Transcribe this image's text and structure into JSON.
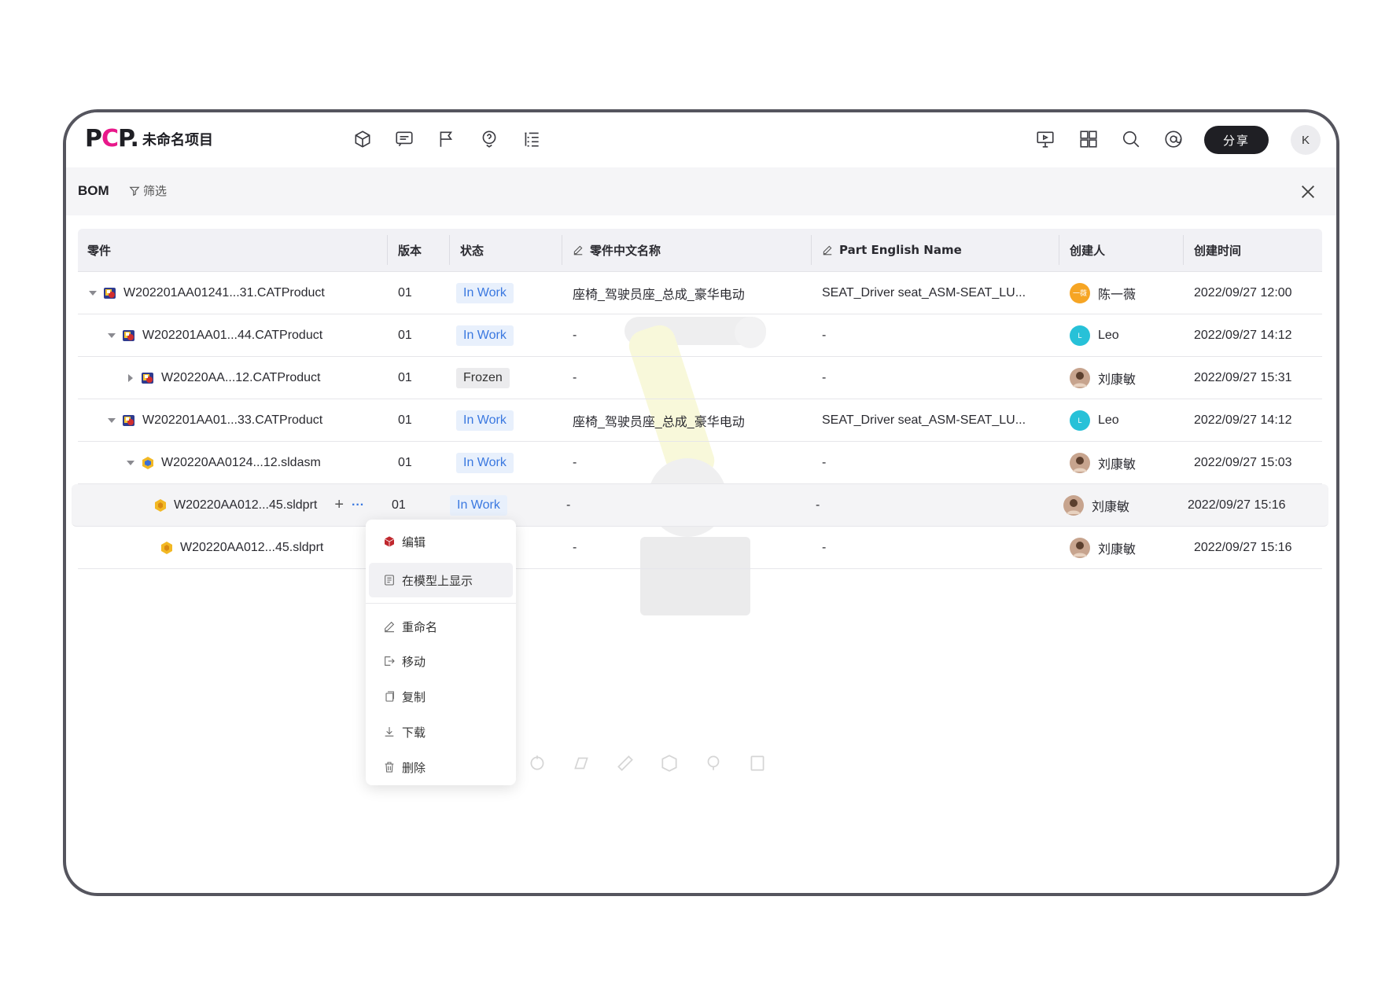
{
  "app": {
    "logo_p": "P",
    "logo_c": "C",
    "logo_rest": "P.",
    "project_title": "未命名项目"
  },
  "toolbar": {
    "left_icons": [
      "cube-icon",
      "comment-icon",
      "flag-icon",
      "help-icon",
      "list-icon"
    ],
    "right_icons": [
      "presentation-icon",
      "grid-icon",
      "search-icon",
      "at-icon"
    ],
    "share_label": "分享",
    "user_initial": "K"
  },
  "bom": {
    "title": "BOM",
    "filter_label": "筛选"
  },
  "columns": [
    "零件",
    "版本",
    "状态",
    "零件中文名称",
    "Part English Name",
    "创建人",
    "创建时间"
  ],
  "rows": [
    {
      "name": "W202201AA01241...31.CATProduct",
      "version": "01",
      "status": "In Work",
      "cn_name": "座椅_驾驶员座_总成_豪华电动",
      "en_name": "SEAT_Driver seat_ASM-SEAT_LU...",
      "creator": "陈一薇",
      "creator_avatar": "一薇",
      "created": "2022/09/27 12:00",
      "level": 0,
      "expander": "expanded",
      "icon": "catproduct-icon"
    },
    {
      "name": "W202201AA01...44.CATProduct",
      "version": "01",
      "status": "In Work",
      "cn_name": "-",
      "en_name": "-",
      "creator": "Leo",
      "creator_avatar": "L",
      "created": "2022/09/27 14:12",
      "level": 1,
      "expander": "expanded",
      "icon": "catproduct-icon"
    },
    {
      "name": "W20220AA...12.CATProduct",
      "version": "01",
      "status": "Frozen",
      "cn_name": "-",
      "en_name": "-",
      "creator": "刘康敏",
      "creator_avatar": "",
      "created": "2022/09/27 15:31",
      "level": 2,
      "expander": "collapsed",
      "icon": "catproduct-icon"
    },
    {
      "name": "W202201AA01...33.CATProduct",
      "version": "01",
      "status": "In Work",
      "cn_name": "座椅_驾驶员座_总成_豪华电动",
      "en_name": "SEAT_Driver seat_ASM-SEAT_LU...",
      "creator": "Leo",
      "creator_avatar": "L",
      "created": "2022/09/27 14:12",
      "level": 1,
      "expander": "expanded",
      "icon": "catproduct-icon"
    },
    {
      "name": "W20220AA0124...12.sldasm",
      "version": "01",
      "status": "In Work",
      "cn_name": "-",
      "en_name": "-",
      "creator": "刘康敏",
      "creator_avatar": "",
      "created": "2022/09/27 15:03",
      "level": 2,
      "expander": "expanded",
      "icon": "sldasm-icon"
    },
    {
      "name": "W20220AA012...45.sldprt",
      "version": "01",
      "status": "In Work",
      "cn_name": "-",
      "en_name": "-",
      "creator": "刘康敏",
      "creator_avatar": "",
      "created": "2022/09/27 15:16",
      "level": 3,
      "expander": "none",
      "icon": "sldprt-icon",
      "highlighted": true,
      "actions": [
        "+",
        "···"
      ]
    },
    {
      "name": "W20220AA012...45.sldprt",
      "version": "",
      "status": "",
      "cn_name": "-",
      "en_name": "-",
      "creator": "刘康敏",
      "creator_avatar": "",
      "created": "2022/09/27 15:16",
      "level": 3,
      "expander": "none",
      "icon": "sldprt-icon"
    }
  ],
  "context_menu": [
    {
      "label": "编辑",
      "icon": "cube-edit-icon"
    },
    {
      "label": "在模型上显示",
      "icon": "show-in-model-icon",
      "active": true
    },
    {
      "label": "重命名",
      "icon": "pencil-icon"
    },
    {
      "label": "移动",
      "icon": "move-icon"
    },
    {
      "label": "复制",
      "icon": "copy-icon"
    },
    {
      "label": "下载",
      "icon": "download-icon"
    },
    {
      "label": "删除",
      "icon": "trash-icon"
    }
  ],
  "colors": {
    "accent_pink": "#e8188a",
    "status_blue": "#3a78e0",
    "status_bg": "#e8f0fc",
    "dark": "#1f1f24"
  }
}
